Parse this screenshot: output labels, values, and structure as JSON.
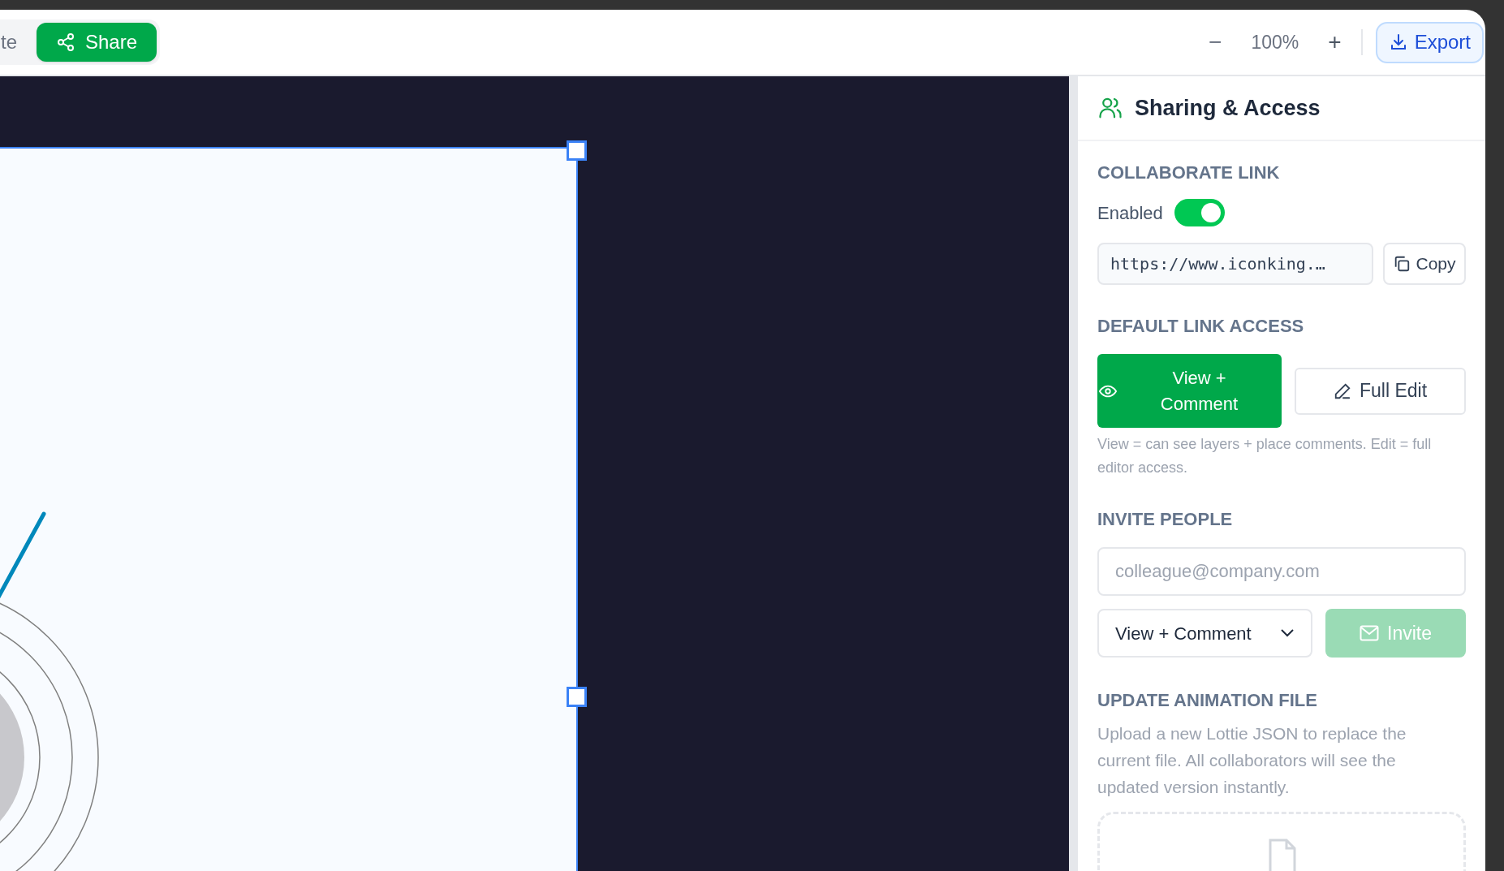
{
  "toolbar": {
    "partial_tab": "te",
    "share_button": "Share",
    "zoom_out": "−",
    "zoom_level": "100%",
    "zoom_in": "+",
    "export_button": "Export"
  },
  "panel": {
    "title": "Sharing & Access",
    "collaborate_link": {
      "heading": "COLLABORATE LINK",
      "toggle_label": "Enabled",
      "on": true,
      "url": "https://www.iconking.…",
      "copy_button": "Copy"
    },
    "default_link_access": {
      "heading": "DEFAULT LINK ACCESS",
      "options": [
        {
          "kind": "view",
          "label": "View + Comment",
          "selected": true
        },
        {
          "kind": "edit",
          "label": "Full Edit",
          "selected": false
        }
      ],
      "note": "View = can see layers + place comments. Edit = full editor access."
    },
    "invite_people": {
      "heading": "INVITE PEOPLE",
      "email_placeholder": "colleague@company.com",
      "role": "View + Comment",
      "invite_button": "Invite",
      "invite_disabled": true
    },
    "update_animation_file": {
      "heading": "UPDATE ANIMATION FILE",
      "description": "Upload a new Lottie JSON to replace the current file. All collaborators will see the updated version instantly."
    }
  }
}
